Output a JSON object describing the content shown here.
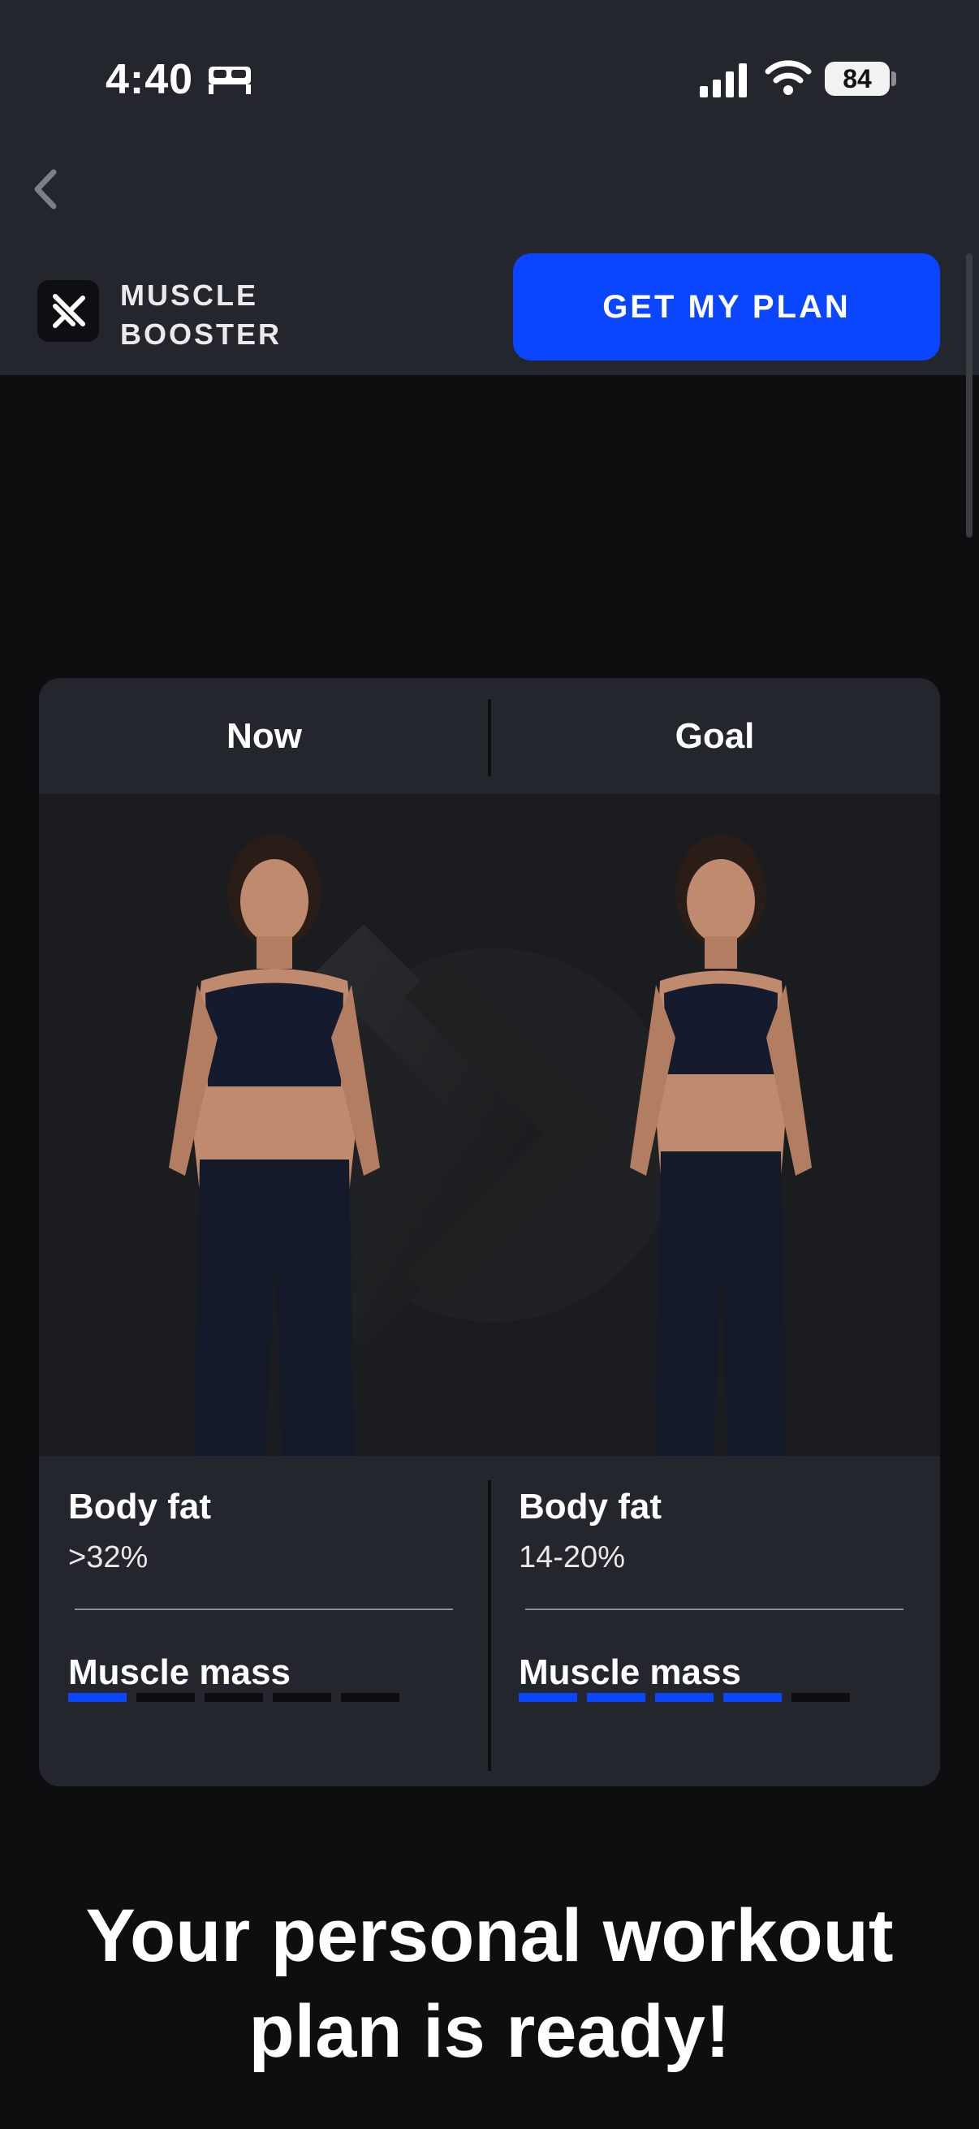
{
  "status_bar": {
    "time": "4:40",
    "battery": "84",
    "icons": [
      "bed-icon",
      "signal-icon",
      "wifi-icon",
      "battery-icon"
    ]
  },
  "header": {
    "back_icon": "chevron-left-icon",
    "logo_line1": "MUSCLE",
    "logo_line2": "BOOSTER",
    "cta_label": "GET MY PLAN"
  },
  "comparison": {
    "now": {
      "label": "Now",
      "body_fat_title": "Body fat",
      "body_fat_value": ">32%",
      "muscle_mass_title": "Muscle mass",
      "muscle_mass_level": 1,
      "muscle_mass_max": 5
    },
    "goal": {
      "label": "Goal",
      "body_fat_title": "Body fat",
      "body_fat_value": "14-20%",
      "muscle_mass_title": "Muscle mass",
      "muscle_mass_level": 4,
      "muscle_mass_max": 5
    }
  },
  "headline": {
    "line1": "Your personal workout",
    "line2": "plan is ready!"
  },
  "colors": {
    "accent": "#0a45ff",
    "background": "#0d0e10",
    "panel": "#23262c"
  }
}
